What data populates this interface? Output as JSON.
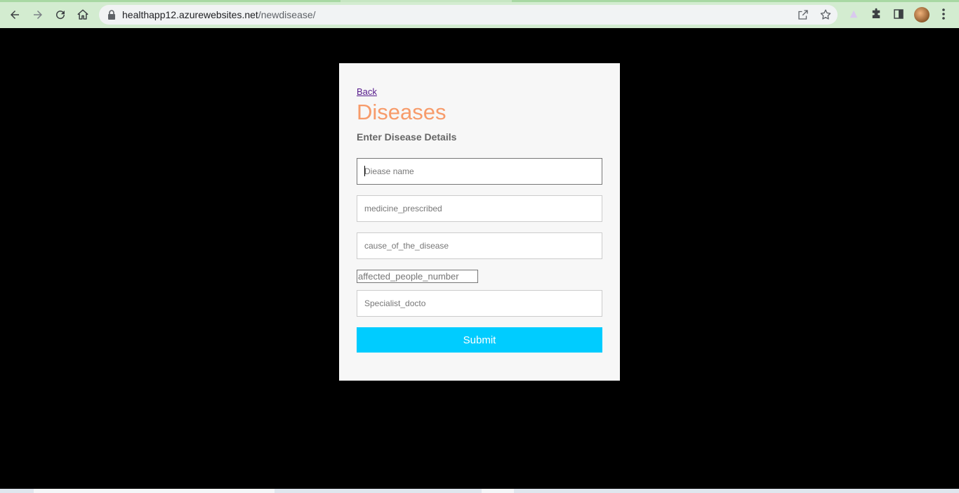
{
  "browser": {
    "url_host": "healthapp12.azurewebsites.net",
    "url_path": "/newdisease/"
  },
  "page": {
    "back_label": "Back",
    "title": "Diseases",
    "subtitle": "Enter Disease Details",
    "fields": {
      "disease_name": {
        "placeholder": "Diease name",
        "value": ""
      },
      "medicine": {
        "placeholder": "medicine_prescribed",
        "value": ""
      },
      "cause": {
        "placeholder": "cause_of_the_disease",
        "value": ""
      },
      "affected": {
        "placeholder": "affected_people_number",
        "value": ""
      },
      "specialist": {
        "placeholder": "Specialist_docto",
        "value": ""
      }
    },
    "submit_label": "Submit"
  },
  "colors": {
    "title": "#f79b6a",
    "submit": "#00ccff",
    "card": "#f7f7f7",
    "background": "#000000"
  }
}
